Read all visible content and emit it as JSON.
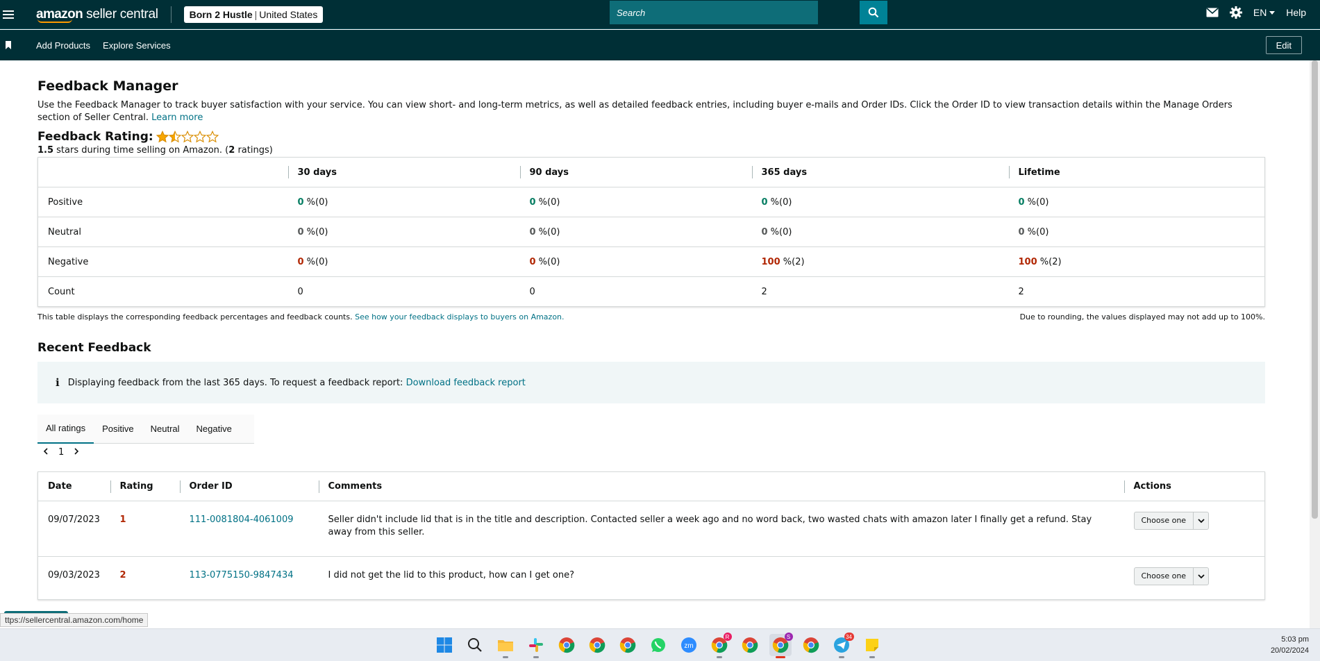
{
  "header": {
    "logo_brand": "amazon",
    "logo_suffix": "seller central",
    "account_name": "Born 2 Hustle",
    "account_separator": "|",
    "account_region": "United States",
    "search_placeholder": "Search",
    "language": "EN",
    "help": "Help"
  },
  "nav": {
    "items": [
      "Add Products",
      "Explore Services"
    ],
    "edit": "Edit"
  },
  "page": {
    "title": "Feedback Manager",
    "description": "Use the Feedback Manager to track buyer satisfaction with your service. You can view short- and long-term metrics, as well as detailed feedback entries, including buyer e-mails and Order IDs. Click the Order ID to view transaction details within the Manage Orders section of Seller Central.",
    "learn_more": "Learn more",
    "rating_title": "Feedback Rating:",
    "rating_stars": 1.5,
    "rating_value": "1.5",
    "rating_text_mid": " stars during time selling on Amazon. (",
    "rating_count": "2",
    "rating_text_end": " ratings)"
  },
  "metrics": {
    "columns": [
      "30 days",
      "90 days",
      "365 days",
      "Lifetime"
    ],
    "rows": [
      {
        "label": "Positive",
        "cells": [
          {
            "v": "0",
            "s": " %(0)",
            "c": "g"
          },
          {
            "v": "0",
            "s": " %(0)",
            "c": "g"
          },
          {
            "v": "0",
            "s": " %(0)",
            "c": "g"
          },
          {
            "v": "0",
            "s": " %(0)",
            "c": "g"
          }
        ]
      },
      {
        "label": "Neutral",
        "cells": [
          {
            "v": "0",
            "s": " %(0)",
            "c": "n"
          },
          {
            "v": "0",
            "s": " %(0)",
            "c": "n"
          },
          {
            "v": "0",
            "s": " %(0)",
            "c": "n"
          },
          {
            "v": "0",
            "s": " %(0)",
            "c": "n"
          }
        ]
      },
      {
        "label": "Negative",
        "cells": [
          {
            "v": "0",
            "s": " %(0)",
            "c": "r"
          },
          {
            "v": "0",
            "s": " %(0)",
            "c": "r"
          },
          {
            "v": "100",
            "s": " %(2)",
            "c": "r"
          },
          {
            "v": "100",
            "s": " %(2)",
            "c": "r"
          }
        ]
      },
      {
        "label": "Count",
        "cells": [
          {
            "v": "",
            "s": "0",
            "c": ""
          },
          {
            "v": "",
            "s": "0",
            "c": ""
          },
          {
            "v": "",
            "s": "2",
            "c": ""
          },
          {
            "v": "",
            "s": "2",
            "c": ""
          }
        ]
      }
    ],
    "note_left": "This table displays the corresponding feedback percentages and feedback counts.",
    "note_link": "See how your feedback displays to buyers on Amazon.",
    "note_right": "Due to rounding, the values displayed may not add up to 100%."
  },
  "recent": {
    "title": "Recent Feedback",
    "alert_icon": "i",
    "alert_text": "Displaying feedback from the last 365 days. To request a feedback report:",
    "alert_link": "Download feedback report",
    "tabs": [
      "All ratings",
      "Positive",
      "Neutral",
      "Negative"
    ],
    "page": "1",
    "columns": [
      "Date",
      "Rating",
      "Order ID",
      "Comments",
      "Actions"
    ],
    "rows": [
      {
        "date": "09/07/2023",
        "rating": "1",
        "order_id": "111-0081804-4061009",
        "comment": "Seller didn't include lid that is in the title and description. Contacted seller a week ago and no word back, two wasted chats with amazon later I finally get a refund. Stay away from this seller.",
        "action": "Choose one"
      },
      {
        "date": "09/03/2023",
        "rating": "2",
        "order_id": "113-0775150-9847434",
        "comment": "I did not get the lid to this product, how can I get one?",
        "action": "Choose one"
      }
    ]
  },
  "status_tooltip": "ttps://sellercentral.amazon.com/home",
  "taskbar": {
    "clock_time": "5:03 pm",
    "clock_date": "20/02/2024",
    "badges": {
      "chrome_r": "R",
      "chrome_s": "S",
      "telegram": "34"
    }
  },
  "colors": {
    "header_bg": "#002f36",
    "link": "#007185",
    "positive": "#067d62",
    "negative": "#b12704"
  }
}
